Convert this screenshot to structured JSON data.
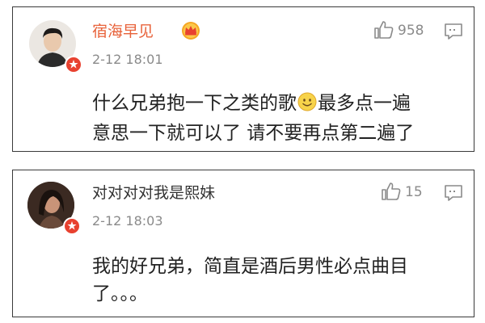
{
  "comments": [
    {
      "username": "宿海早见",
      "username_color": "#e8623a",
      "member_badge_icon": "weibo-member-crown-icon",
      "verified_icon": "verified-v-badge-icon",
      "time": "2-12 18:01",
      "like_count": "958",
      "text_before_emoji": "什么兄弟抱一下之类的歌",
      "emoji": "smile-emoji",
      "text_after_emoji": "最多点一遍",
      "text_line2": "意思一下就可以了 请不要再点第二遍了"
    },
    {
      "username": "对对对对我是熙妹",
      "username_color": "#333333",
      "verified_icon": "verified-v-badge-icon",
      "time": "2-12 18:03",
      "like_count": "15",
      "text_line1": "我的好兄弟，简直是酒后男性必点曲目",
      "text_line2": "了。。。"
    }
  ],
  "colors": {
    "verified_badge": "#e8412f",
    "icon_gray": "#8a8a8a",
    "card_border": "#3a3a3a"
  }
}
